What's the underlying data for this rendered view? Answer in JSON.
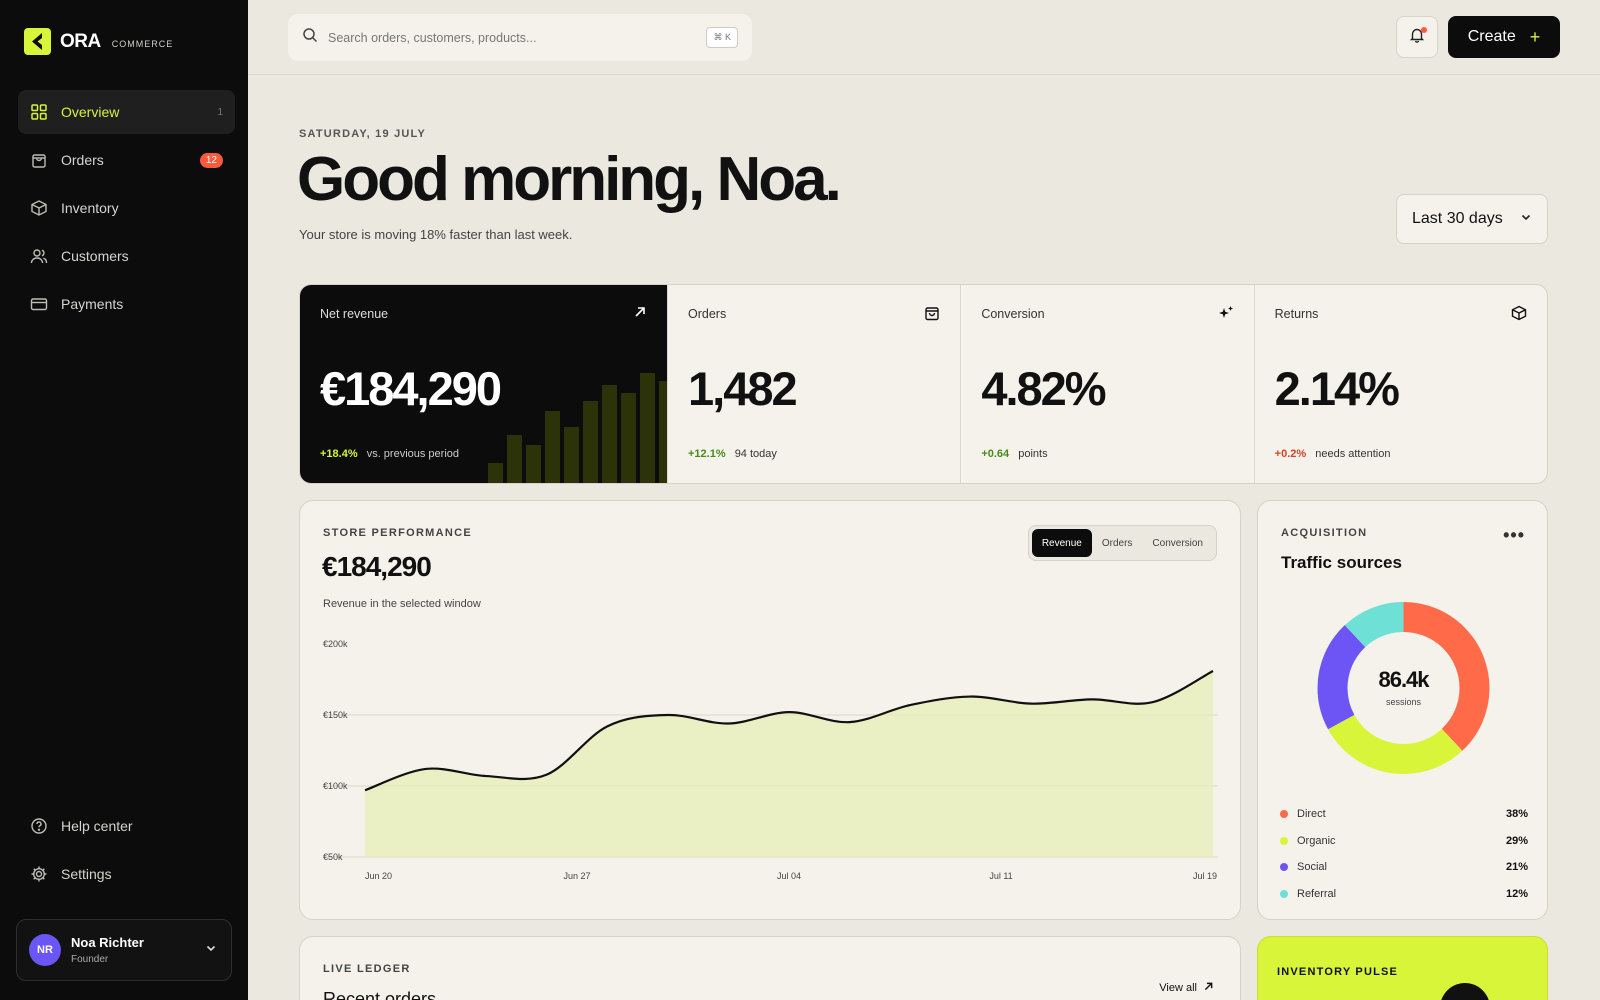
{
  "brand": {
    "name": "ORA",
    "sub": "COMMERCE",
    "accent": "#d8f53a"
  },
  "sidebar": {
    "items": [
      {
        "label": "Overview",
        "count": "1",
        "icon": "grid-icon",
        "active": true
      },
      {
        "label": "Orders",
        "badge": "12",
        "icon": "shopping-bag-icon"
      },
      {
        "label": "Inventory",
        "icon": "box-icon"
      },
      {
        "label": "Customers",
        "icon": "users-icon"
      },
      {
        "label": "Payments",
        "icon": "credit-card-icon"
      }
    ],
    "bottom": [
      {
        "label": "Help center",
        "icon": "help-circle-icon"
      },
      {
        "label": "Settings",
        "icon": "gear-icon"
      }
    ],
    "user": {
      "initials": "NR",
      "name": "Noa Richter",
      "role": "Founder"
    }
  },
  "topbar": {
    "search_placeholder": "Search orders, customers, products...",
    "shortcut": "⌘ K",
    "create_label": "Create",
    "create_icon": "+"
  },
  "header": {
    "date": "SATURDAY, 19 JULY",
    "greeting": "Good morning, Noa.",
    "subline": "Your store is moving 18% faster than last week.",
    "range": "Last 30 days"
  },
  "kpis": [
    {
      "label": "Net revenue",
      "value": "€184,290",
      "delta": "+18.4%",
      "note": "vs. previous period",
      "icon": "arrow-up-right-icon"
    },
    {
      "label": "Orders",
      "value": "1,482",
      "delta": "+12.1%",
      "note": "94 today",
      "icon": "shopping-bag-icon"
    },
    {
      "label": "Conversion",
      "value": "4.82%",
      "delta": "+0.64",
      "note": "points",
      "icon": "sparkle-icon"
    },
    {
      "label": "Returns",
      "value": "2.14%",
      "delta": "+0.2%",
      "note": "needs attention",
      "icon": "box-icon"
    }
  ],
  "performance": {
    "kicker": "STORE PERFORMANCE",
    "value": "€184,290",
    "note": "Revenue in the selected window",
    "tabs": [
      "Revenue",
      "Orders",
      "Conversion"
    ],
    "active_tab": "Revenue"
  },
  "chart_data": {
    "type": "area",
    "x": [
      "Jun 20",
      "Jun 23",
      "Jun 25",
      "Jun 27",
      "Jun 30",
      "Jul 02",
      "Jul 04",
      "Jul 06",
      "Jul 07",
      "Jul 09",
      "Jul 11",
      "Jul 13",
      "Jul 15",
      "Jul 17",
      "Jul 19"
    ],
    "x_ticks": [
      "Jun 20",
      "Jun 27",
      "Jul 04",
      "Jul 11",
      "Jul 19"
    ],
    "values": [
      97,
      112,
      107,
      108,
      142,
      150,
      144,
      152,
      145,
      157,
      163,
      158,
      161,
      159,
      181
    ],
    "y_ticks": [
      "€200k",
      "€150k",
      "€100k",
      "€50k"
    ],
    "ylim": [
      50,
      200
    ],
    "line_color": "#111111",
    "fill_color": "#e6f0b4"
  },
  "acquisition": {
    "kicker": "ACQUISITION",
    "title": "Traffic sources",
    "center_value": "86.4k",
    "center_label": "sessions",
    "sources": [
      {
        "label": "Direct",
        "value": "38%",
        "pct": 38,
        "color": "#ff6a48"
      },
      {
        "label": "Organic",
        "value": "29%",
        "pct": 29,
        "color": "#d8f53a"
      },
      {
        "label": "Social",
        "value": "21%",
        "pct": 21,
        "color": "#6d55f5"
      },
      {
        "label": "Referral",
        "value": "12%",
        "pct": 12,
        "color": "#6fe0d6"
      }
    ]
  },
  "ledger": {
    "kicker": "LIVE LEDGER",
    "title": "Recent orders",
    "view_all": "View all"
  },
  "pulse": {
    "kicker": "INVENTORY PULSE"
  }
}
